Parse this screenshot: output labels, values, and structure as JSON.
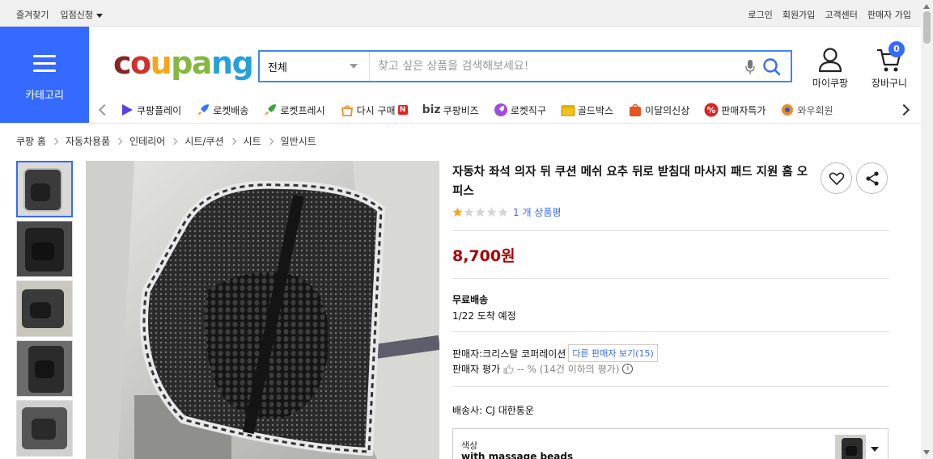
{
  "topbar": {
    "left": [
      "즐겨찾기",
      "입점신청"
    ],
    "right": [
      "로그인",
      "회원가입",
      "고객센터",
      "판매자 가입"
    ]
  },
  "category_button": {
    "label": "카테고리"
  },
  "logo": {
    "parts": [
      "c",
      "o",
      "u",
      "pa",
      "ng"
    ]
  },
  "search": {
    "category": "전체",
    "placeholder": "찾고 싶은 상품을 검색해보세요!"
  },
  "header": {
    "mycoupang": "마이쿠팡",
    "cart": "장바구니",
    "cart_count": "0"
  },
  "nav": {
    "items": [
      {
        "label": "쿠팡플레이",
        "icon": "play-icon",
        "color": "#5a3fe0"
      },
      {
        "label": "로켓배송",
        "icon": "rocket-icon",
        "color": "#2f7cf6"
      },
      {
        "label": "로켓프레시",
        "icon": "rocket-fresh-icon",
        "color": "#3aa53a"
      },
      {
        "label": "다시 구매",
        "icon": "repurchase-icon",
        "color": "#f08a24"
      },
      {
        "label": "쿠팡비즈",
        "icon": "biz-icon",
        "color": "#444"
      },
      {
        "label": "로켓직구",
        "icon": "rocket-direct-icon",
        "color": "#a04be0"
      },
      {
        "label": "골드박스",
        "icon": "gold-box-icon",
        "color": "#e5b100"
      },
      {
        "label": "이달의신상",
        "icon": "new-bag-icon",
        "color": "#e8541e"
      },
      {
        "label": "판매자특가",
        "icon": "percent-icon",
        "color": "#d22"
      },
      {
        "label": "와우회원",
        "icon": "wow-icon",
        "color": "#1f5fe0"
      }
    ],
    "biz_prefix": "biz",
    "badge_n": "N"
  },
  "breadcrumb": [
    "쿠팡 홈",
    "자동차용품",
    "인테리어",
    "시트/쿠션",
    "시트",
    "일반시트"
  ],
  "product": {
    "title": "자동차 좌석 의자 뒤 쿠션 메쉬 요추 뒤로 받침대 마사지 패드 지원 홈 오피스",
    "rating_stars": 1,
    "rating_max": 5,
    "reviews": "1 개 상품평",
    "price": "8,700원",
    "shipping_title": "무료배송",
    "shipping_date": "1/22 도착 예정",
    "seller": "판매자:크리스탈 코퍼레이션",
    "other_sellers": "다른 판매자 보기(15)",
    "seller_rating_label": "판매자 평가",
    "seller_rating_value": "-- %",
    "seller_rating_note": "(14건 이하의 평가)",
    "carrier": "배송사:  CJ 대한통운",
    "option_label": "색상",
    "option_value": "with massage beads"
  },
  "colors": {
    "brand_blue": "#346aff",
    "price_red": "#ae0000",
    "star_gold": "#f5a623"
  }
}
